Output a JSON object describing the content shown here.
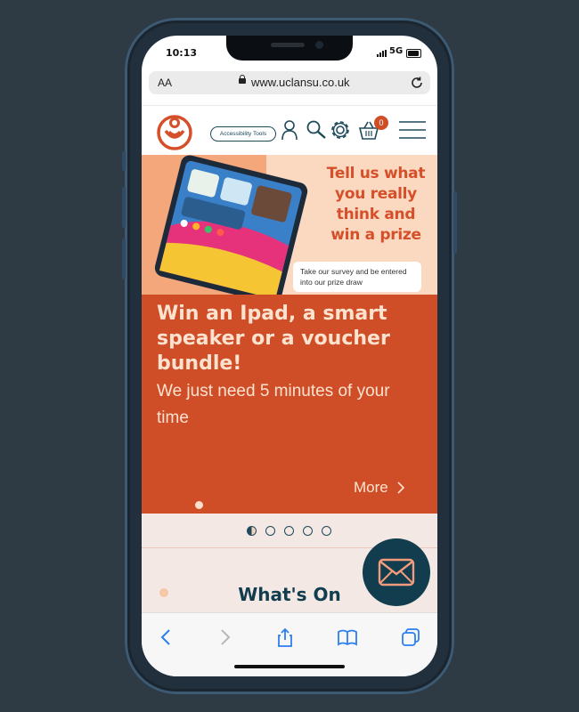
{
  "status": {
    "time": "10:13",
    "network": "5G"
  },
  "browser": {
    "aa_label": "AA",
    "url": "www.uclansu.co.uk"
  },
  "header": {
    "accessibility_label": "Accessibility Tools",
    "cart_count": "0"
  },
  "banner": {
    "tagline": [
      "Tell us what",
      "you really",
      "think and",
      "win a prize"
    ],
    "subcard": "Take our survey and be entered into our prize draw"
  },
  "slide": {
    "title": "Win an Ipad, a smart speaker or a voucher bundle!",
    "subtitle": "We just need 5 minutes of your time",
    "more_label": "More"
  },
  "carousel": {
    "count": 5,
    "active_index": 0
  },
  "section": {
    "title": "What's On"
  },
  "colors": {
    "brand_orange": "#cf4e28",
    "brand_teal": "#113d4e",
    "peach": "#fde3cf"
  },
  "icons": [
    "user-icon",
    "search-icon",
    "gear-icon",
    "basket-icon",
    "menu-icon",
    "mail-icon",
    "back-icon",
    "forward-icon",
    "share-icon",
    "bookmarks-icon",
    "tabs-icon",
    "reload-icon",
    "lock-icon"
  ]
}
